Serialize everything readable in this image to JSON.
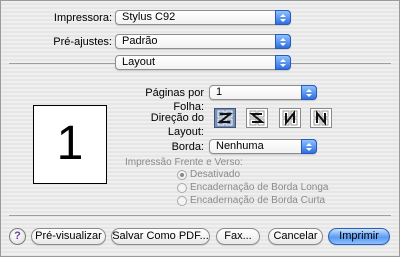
{
  "printer": {
    "label": "Impressora:",
    "value": "Stylus C92"
  },
  "presets": {
    "label": "Pré-ajustes:",
    "value": "Padrão"
  },
  "panel": {
    "value": "Layout"
  },
  "preview": {
    "page_number": "1"
  },
  "pages_per_sheet": {
    "label": "Páginas por Folha:",
    "value": "1"
  },
  "layout_direction": {
    "label": "Direção do Layout:",
    "options": [
      "z-left-to-right",
      "z-reversed",
      "n-top-to-bottom",
      "n-reversed"
    ],
    "selected_index": 0
  },
  "border": {
    "label": "Borda:",
    "value": "Nenhuma"
  },
  "duplex": {
    "label": "Impressão Frente e Verso:",
    "options": [
      "Desativado",
      "Encadernação de Borda Longa",
      "Encadernação de Borda Curta"
    ],
    "selected": "Desativado"
  },
  "buttons": {
    "help": "?",
    "preview": "Pré-visualizar",
    "save_pdf": "Salvar Como PDF...",
    "fax": "Fax...",
    "cancel": "Cancelar",
    "print": "Imprimir"
  },
  "colors": {
    "accent": "#2f6fe0",
    "selected_layout": "#7a8fb3"
  }
}
